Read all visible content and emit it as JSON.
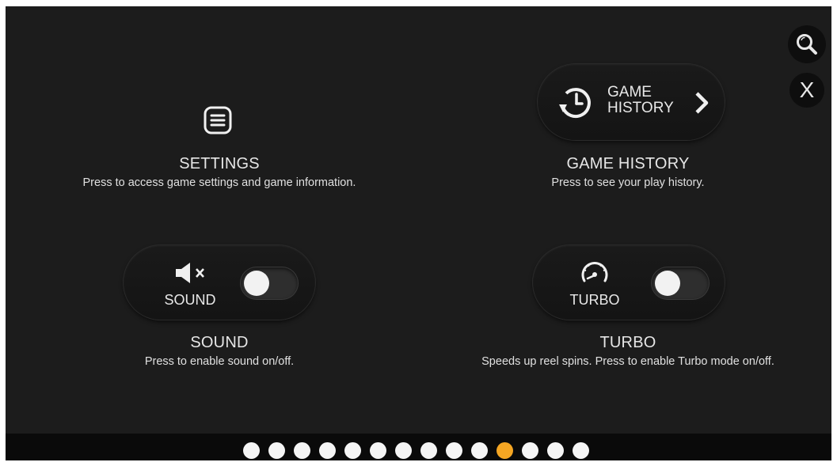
{
  "settings": {
    "title": "SETTINGS",
    "desc": "Press to access game settings and game information."
  },
  "history": {
    "button_line1": "GAME",
    "button_line2": "HISTORY",
    "title": "GAME HISTORY",
    "desc": "Press to see your play history."
  },
  "sound": {
    "button_label": "SOUND",
    "title": "SOUND",
    "desc": "Press to enable sound on/off.",
    "enabled": false
  },
  "turbo": {
    "button_label": "TURBO",
    "title": "TURBO",
    "desc": "Speeds up reel spins. Press to enable Turbo mode on/off.",
    "enabled": false
  },
  "close_label": "X",
  "pagination": {
    "total": 14,
    "active_index": 10,
    "active_color": "#f5a623",
    "dot_color": "#f5f5f5"
  },
  "icons": {
    "search": "search-icon",
    "settings": "menu-icon",
    "history": "clock-history-icon",
    "sound": "speaker-muted-icon",
    "turbo": "speedometer-icon"
  }
}
